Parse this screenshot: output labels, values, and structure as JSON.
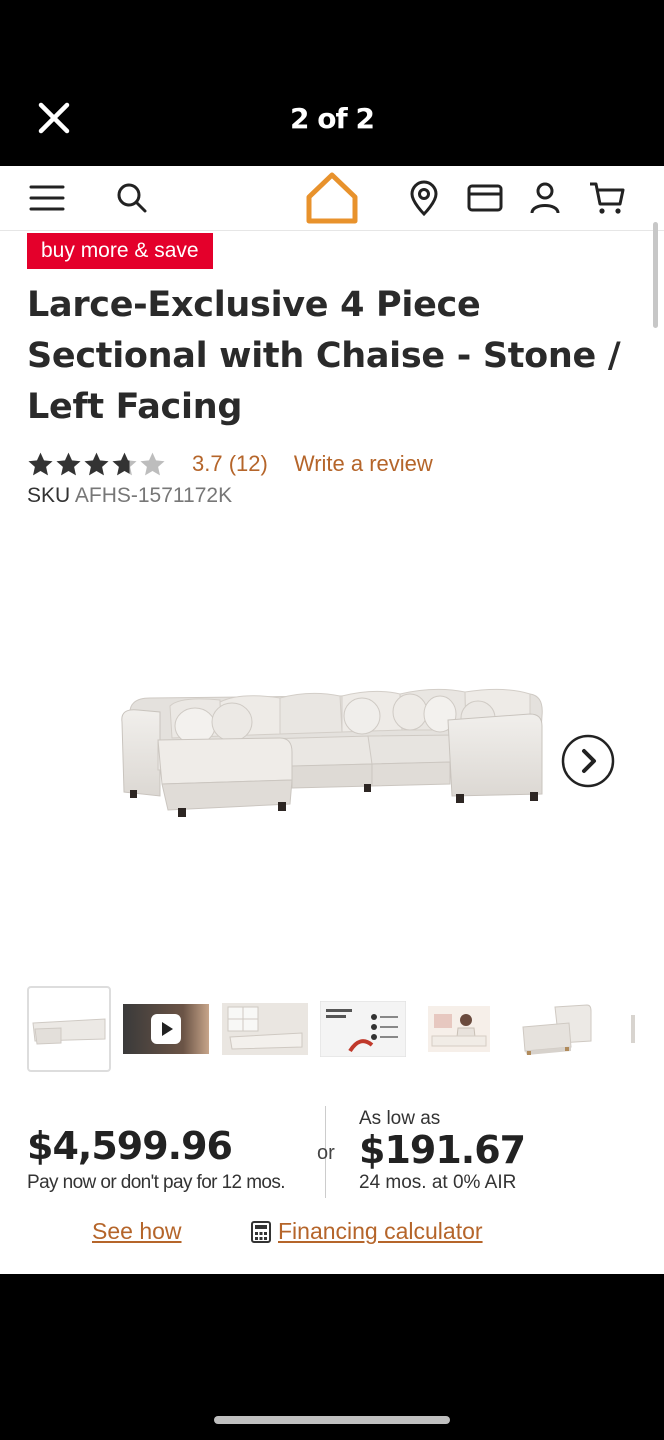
{
  "viewer": {
    "counter": "2 of 2",
    "close_icon": "close-icon"
  },
  "nav": {
    "icons": [
      "menu-icon",
      "search-icon",
      "home-logo-icon",
      "location-pin-icon",
      "credit-card-icon",
      "account-icon",
      "cart-icon"
    ],
    "logo_color": "#e8922c"
  },
  "promo": {
    "label": "buy more & save",
    "color": "#e4002b"
  },
  "product": {
    "title": "Larce-Exclusive 4 Piece Sectional with Chaise - Stone / Left Facing",
    "rating_value": 3.7,
    "rating_text": "3.7 (12)",
    "review_link": "Write a review",
    "sku_label": "SKU",
    "sku": "AFHS-1571172K"
  },
  "gallery": {
    "next_icon": "chevron-right-icon",
    "thumbnails": [
      "sectional-front",
      "video",
      "room-scene",
      "feature-graphic",
      "lifestyle",
      "chaise-piece",
      "partial"
    ],
    "selected_index": 0
  },
  "pricing": {
    "price": "$4,599.96",
    "price_note": "Pay now or don't pay for 12 mos.",
    "or": "or",
    "as_low_as": "As low as",
    "monthly": "$191.67",
    "monthly_note": "24 mos. at 0% AIR"
  },
  "links": {
    "see_how": "See how",
    "financing": "Financing calculator",
    "financing_icon": "calculator-icon"
  },
  "colors": {
    "accent_link": "#b5652a",
    "text": "#2a2a2a"
  }
}
